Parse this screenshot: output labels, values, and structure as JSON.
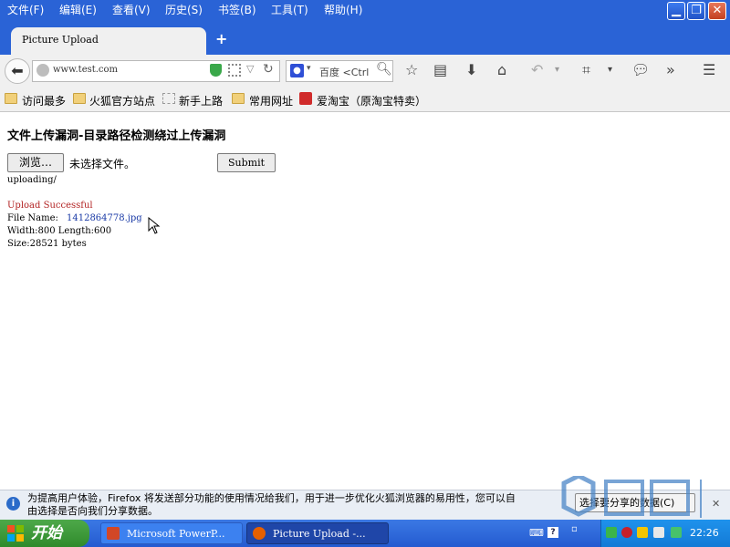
{
  "menubar": {
    "items": [
      "文件(F)",
      "编辑(E)",
      "查看(V)",
      "历史(S)",
      "书签(B)",
      "工具(T)",
      "帮助(H)"
    ]
  },
  "tab": {
    "title": "Picture Upload"
  },
  "navbar": {
    "url": "www.test.com",
    "search_engine": "百度",
    "search_placeholder": "<Ctrl"
  },
  "bookmarks": {
    "items": [
      "访问最多",
      "火狐官方站点",
      "新手上路",
      "常用网址",
      "爱淘宝（原淘宝特卖）"
    ]
  },
  "content": {
    "heading": "文件上传漏洞-目录路径检测绕过上传漏洞",
    "browse_label": "浏览…",
    "no_file_text": "未选择文件。",
    "submit_label": "Submit",
    "upload_path": "uploading/",
    "success_text": "Upload Successful",
    "file_name_label": "File Name:",
    "file_name": "1412864778.jpg",
    "dimensions": "Width:800 Length:600",
    "size": "Size:28521 bytes"
  },
  "notification": {
    "line1": "为提高用户体验，Firefox 将发送部分功能的使用情况给我们，用于进一步优化火狐浏览器的易用性，您可以自",
    "line2": "由选择是否向我们分享数据。",
    "button_label": "选择要分享的数据(C)"
  },
  "taskbar": {
    "start_label": "开始",
    "tasks": [
      "Microsoft PowerP...",
      "Picture Upload -..."
    ],
    "clock": "22:26"
  },
  "colors": {
    "titlebar_blue": "#2a63d6",
    "error_red": "#b22222",
    "link_blue": "#1a3aa6",
    "taskbar_blue": "#245ad0",
    "start_green": "#2f8a2b"
  }
}
